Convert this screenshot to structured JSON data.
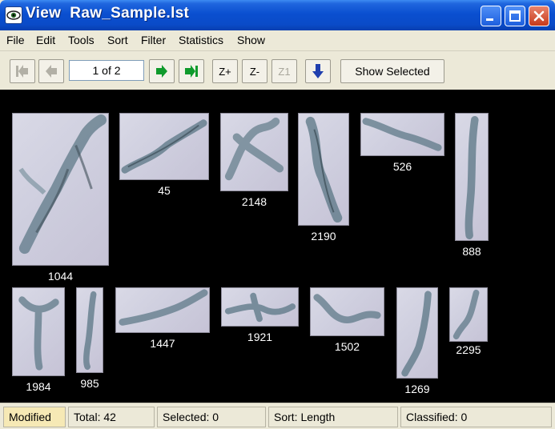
{
  "window": {
    "title": "View  Raw_Sample.lst"
  },
  "menu": {
    "items": [
      "File",
      "Edit",
      "Tools",
      "Sort",
      "Filter",
      "Statistics",
      "Show"
    ]
  },
  "toolbar": {
    "page_indicator": "1 of 2",
    "zoom_in_label": "Z+",
    "zoom_out_label": "Z-",
    "zoom_one_label": "Z1",
    "show_selected_label": "Show Selected",
    "icons": [
      "first-page-icon",
      "previous-page-icon",
      "next-page-icon",
      "last-page-icon",
      "download-icon"
    ],
    "colors": {
      "nav_green": "#0f9a2c",
      "nav_disabled": "#b2b0a6",
      "download_blue": "#1f3fae"
    }
  },
  "particles": [
    {
      "label": "1044"
    },
    {
      "label": "45"
    },
    {
      "label": "2148"
    },
    {
      "label": "2190"
    },
    {
      "label": "526"
    },
    {
      "label": "888"
    },
    {
      "label": "1984"
    },
    {
      "label": "985"
    },
    {
      "label": "1447"
    },
    {
      "label": "1921"
    },
    {
      "label": "1502"
    },
    {
      "label": "1269"
    },
    {
      "label": "2295"
    }
  ],
  "status": {
    "state": "Modified",
    "total": "Total:  42",
    "selected": "Selected:  0",
    "sort": "Sort: Length",
    "classified": "Classified:  0"
  },
  "colors": {
    "titlebar": "#0a4fd0",
    "viewer_background": "#000000",
    "modified_panel": "#f6e9b5"
  }
}
